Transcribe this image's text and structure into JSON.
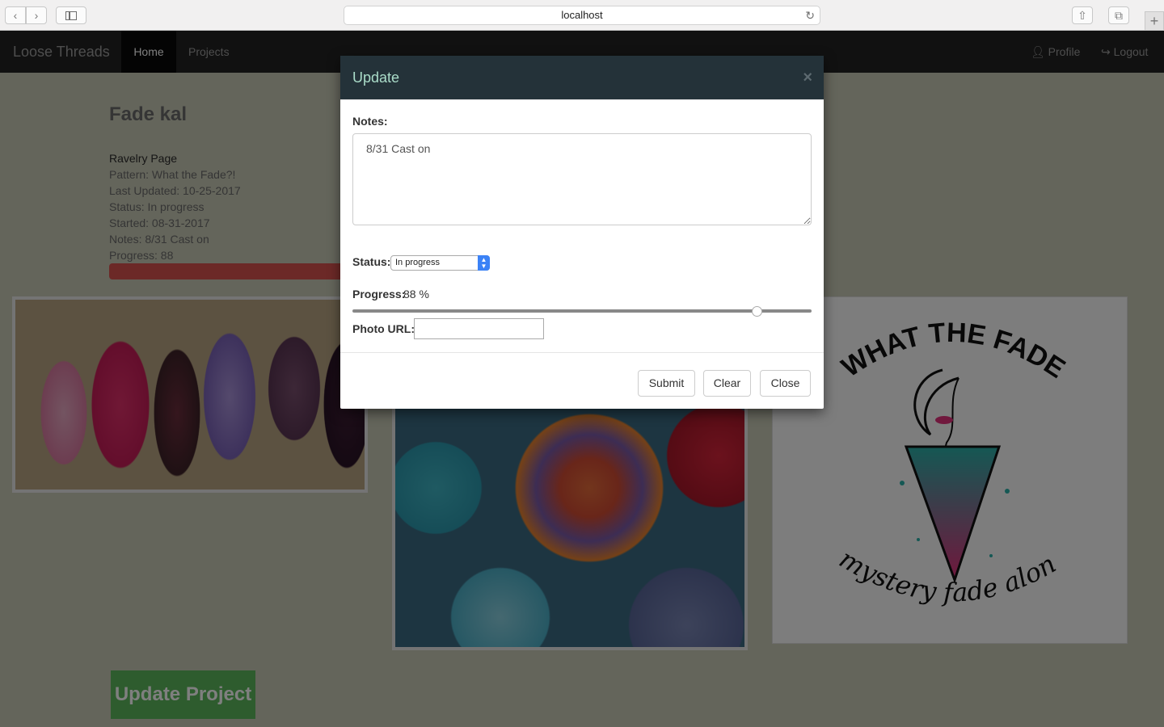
{
  "browser": {
    "url": "localhost"
  },
  "navbar": {
    "brand": "Loose Threads",
    "items": [
      "Home",
      "Projects"
    ],
    "profile": "Profile",
    "logout": "Logout"
  },
  "project": {
    "title": "Fade kal",
    "ravelry_link": "Ravelry Page",
    "pattern": "Pattern: What the Fade?!",
    "last_updated": "Last Updated: 10-25-2017",
    "status": "Status: In progress",
    "started": "Started: 08-31-2017",
    "notes": "Notes: 8/31 Cast on",
    "progress_text": "Progress: 88",
    "progress_value": 88,
    "update_button": "Update Project"
  },
  "logo": {
    "top_text": "WHAT THE FADE?!",
    "bottom_text": "mystery fade along"
  },
  "modal": {
    "title": "Update",
    "close_symbol": "×",
    "notes_label": "Notes:",
    "notes_value": "8/31 Cast on",
    "status_label": "Status:",
    "status_value": "In progress",
    "progress_label": "Progress:",
    "progress_display": "88 %",
    "progress_value": 88,
    "photo_url_label": "Photo URL:",
    "photo_url_value": "",
    "buttons": {
      "submit": "Submit",
      "clear": "Clear",
      "close": "Close"
    }
  },
  "colors": {
    "navbar_bg": "#222222",
    "modal_header_bg": "#243239",
    "modal_title": "#aadcc9",
    "progress_bar": "#d9534f",
    "update_button": "#5cb85c"
  }
}
